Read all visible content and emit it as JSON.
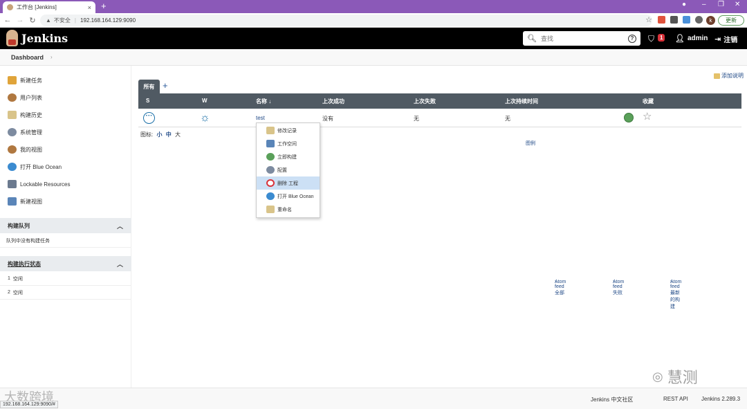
{
  "browser": {
    "tab_title": "工作台 [Jenkins]",
    "tab_close": "×",
    "new_tab": "+",
    "insecure_label": "不安全",
    "url": "192.168.164.129:9090",
    "update_label": "更新",
    "profile_initial": "k",
    "status_url": "192.168.164.129:9090/#"
  },
  "header": {
    "brand": "Jenkins",
    "search_placeholder": "查找",
    "alert_count": "1",
    "user": "admin",
    "logout": "注销"
  },
  "breadcrumb": {
    "root": "Dashboard"
  },
  "sidebar": {
    "items": [
      {
        "label": "新建任务",
        "icon": "new-item-icon",
        "color": "#e0a43a"
      },
      {
        "label": "用户列表",
        "icon": "people-icon",
        "color": "#b07840"
      },
      {
        "label": "构建历史",
        "icon": "notepad-icon",
        "color": "#d9c48a"
      },
      {
        "label": "系统管理",
        "icon": "gear-icon",
        "color": "#7d8ba0"
      },
      {
        "label": "我的视图",
        "icon": "user-view-icon",
        "color": "#b07840"
      },
      {
        "label": "打开 Blue Ocean",
        "icon": "blue-ocean-icon",
        "color": "#3b8bd0"
      },
      {
        "label": "Lockable Resources",
        "icon": "lock-resource-icon",
        "color": "#6b7a8f"
      },
      {
        "label": "新建视图",
        "icon": "folder-icon",
        "color": "#5a85b8"
      }
    ],
    "build_queue": {
      "title": "构建队列",
      "empty": "队列中没有构建任务"
    },
    "executors": {
      "title": "构建执行状态",
      "rows": [
        {
          "num": "1",
          "status": "空闲"
        },
        {
          "num": "2",
          "status": "空闲"
        }
      ]
    }
  },
  "main": {
    "add_description": "添加说明",
    "view_tab": "所有",
    "view_add": "+",
    "columns": [
      "S",
      "W",
      "名称 ↓",
      "上次成功",
      "上次失败",
      "上次持续时间",
      "收藏"
    ],
    "jobs": [
      {
        "name": "test",
        "last_success": "没有",
        "last_failure": "无",
        "last_duration": "无"
      }
    ],
    "icon_size": {
      "label": "图标:",
      "small": "小",
      "medium": "中",
      "large": "大"
    },
    "feeds": {
      "legend": "图例",
      "all": "Atom feed 全部",
      "failed": "Atom feed 失败",
      "latest": "Atom feed 最新的构建"
    }
  },
  "context_menu": {
    "items": [
      {
        "label": "修改记录",
        "icon": "changes-icon",
        "color": "#d9c48a",
        "highlight": false
      },
      {
        "label": "工作空间",
        "icon": "workspace-folder-icon",
        "color": "#5a85b8",
        "highlight": false
      },
      {
        "label": "立即构建",
        "icon": "build-now-icon",
        "color": "#5aa05a",
        "highlight": false
      },
      {
        "label": "配置",
        "icon": "configure-gear-icon",
        "color": "#7d8ba0",
        "highlight": false
      },
      {
        "label": "删除 工程",
        "icon": "delete-icon",
        "color": "#d9323a",
        "highlight": true
      },
      {
        "label": "打开 Blue Ocean",
        "icon": "blue-ocean-icon",
        "color": "#3b8bd0",
        "highlight": false
      },
      {
        "label": "重命名",
        "icon": "rename-icon",
        "color": "#d9c48a",
        "highlight": false
      }
    ]
  },
  "footer": {
    "community": "Jenkins 中文社区",
    "rest_api": "REST API",
    "version": "Jenkins 2.289.3"
  },
  "watermarks": {
    "right": "慧测",
    "left": "大数跨境"
  }
}
